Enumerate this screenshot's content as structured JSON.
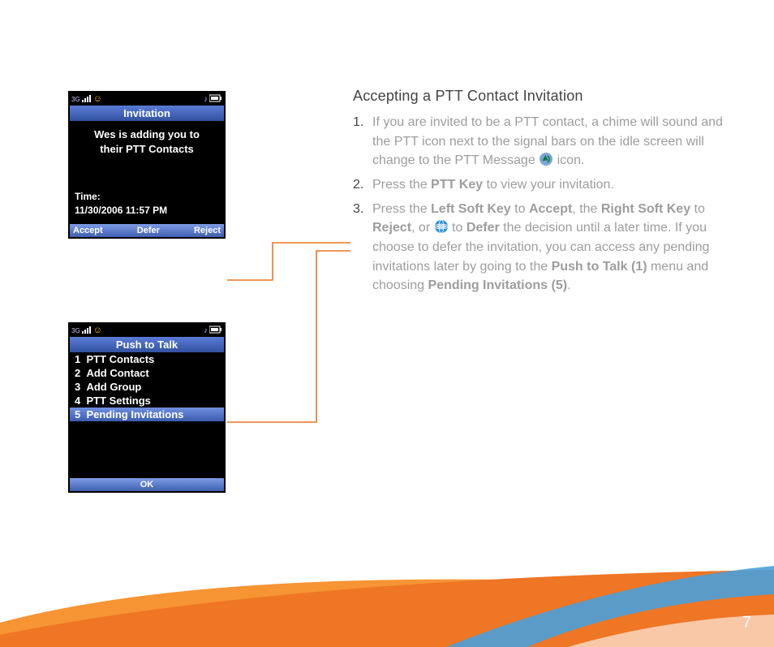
{
  "phone1": {
    "title": "Invitation",
    "message_line1": "Wes is adding you to",
    "message_line2": "their PTT Contacts",
    "time_label": "Time:",
    "time_value": "11/30/2006 11:57 PM",
    "softkeys": {
      "left": "Accept",
      "center": "Defer",
      "right": "Reject"
    },
    "status": {
      "net": "3G",
      "smiley": "☺"
    }
  },
  "phone2": {
    "title": "Push to Talk",
    "items": [
      {
        "num": "1",
        "label": "PTT Contacts"
      },
      {
        "num": "2",
        "label": "Add Contact"
      },
      {
        "num": "3",
        "label": "Add Group"
      },
      {
        "num": "4",
        "label": "PTT Settings"
      },
      {
        "num": "5",
        "label": "Pending Invitations"
      }
    ],
    "softkey_center": "OK"
  },
  "content": {
    "heading": "Accepting a PTT Contact Invitation",
    "step1_a": "If you are invited to be a PTT contact, a chime will sound and the PTT icon next to the signal bars on the idle screen will change to the PTT Message ",
    "step1_b": " icon.",
    "step2_a": "Press the ",
    "step2_ptt": "PTT Key",
    "step2_b": " to view your invitation.",
    "step3_a": "Press the ",
    "step3_lsk": "Left Soft Key",
    "step3_b": " to ",
    "step3_accept": "Accept",
    "step3_c": ", the ",
    "step3_rsk": "Right Soft Key",
    "step3_d": " to ",
    "step3_reject": "Reject",
    "step3_e": ", or ",
    "step3_f": " to ",
    "step3_defer": "Defer",
    "step3_g": " the decision until a later time. If you choose to defer the invitation, you can access any pending invitations later by going to the ",
    "step3_ptt1": "Push to Talk (1)",
    "step3_h": " menu and choosing ",
    "step3_pi5": "Pending Invitations (5)",
    "step3_i": "."
  },
  "page_number": "7"
}
